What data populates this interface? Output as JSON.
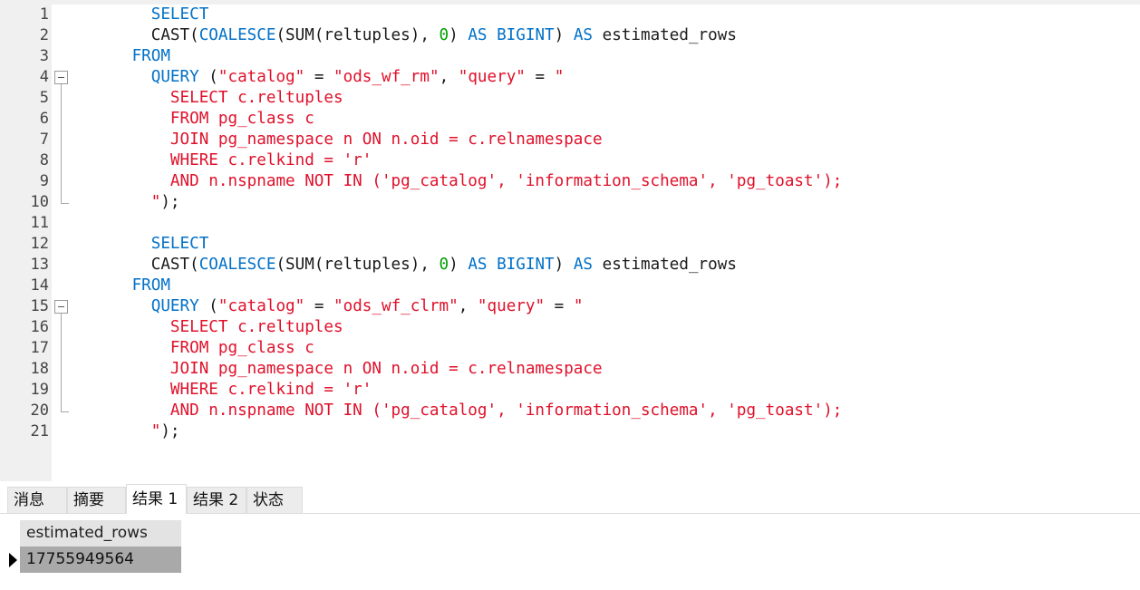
{
  "editor": {
    "lines": [
      {
        "n": "1",
        "tokens": [
          {
            "t": "        ",
            "c": "txt"
          },
          {
            "t": "SELECT",
            "c": "kw"
          }
        ]
      },
      {
        "n": "2",
        "tokens": [
          {
            "t": "        CAST(",
            "c": "txt"
          },
          {
            "t": "COALESCE",
            "c": "kw"
          },
          {
            "t": "(SUM(reltuples), ",
            "c": "txt"
          },
          {
            "t": "0",
            "c": "num"
          },
          {
            "t": ") ",
            "c": "txt"
          },
          {
            "t": "AS BIGINT",
            "c": "kw"
          },
          {
            "t": ") ",
            "c": "txt"
          },
          {
            "t": "AS",
            "c": "kw"
          },
          {
            "t": " estimated_rows",
            "c": "txt"
          }
        ]
      },
      {
        "n": "3",
        "tokens": [
          {
            "t": "      ",
            "c": "txt"
          },
          {
            "t": "FROM",
            "c": "kw"
          }
        ]
      },
      {
        "n": "4",
        "fold": "start",
        "tokens": [
          {
            "t": "        ",
            "c": "txt"
          },
          {
            "t": "QUERY",
            "c": "kw"
          },
          {
            "t": " (",
            "c": "txt"
          },
          {
            "t": "\"catalog\"",
            "c": "str"
          },
          {
            "t": " = ",
            "c": "txt"
          },
          {
            "t": "\"ods_wf_rm\"",
            "c": "str"
          },
          {
            "t": ", ",
            "c": "txt"
          },
          {
            "t": "\"query\"",
            "c": "str"
          },
          {
            "t": " = ",
            "c": "txt"
          },
          {
            "t": "\"",
            "c": "str"
          }
        ]
      },
      {
        "n": "5",
        "fold": "mid",
        "tokens": [
          {
            "t": "          SELECT c.reltuples",
            "c": "str"
          }
        ]
      },
      {
        "n": "6",
        "fold": "mid",
        "tokens": [
          {
            "t": "          FROM pg_class c",
            "c": "str"
          }
        ]
      },
      {
        "n": "7",
        "fold": "mid",
        "tokens": [
          {
            "t": "          JOIN pg_namespace n ON n.oid = c.relnamespace",
            "c": "str"
          }
        ]
      },
      {
        "n": "8",
        "fold": "mid",
        "tokens": [
          {
            "t": "          WHERE c.relkind = 'r'",
            "c": "str"
          }
        ]
      },
      {
        "n": "9",
        "fold": "mid",
        "tokens": [
          {
            "t": "          AND n.nspname NOT IN ('pg_catalog', 'information_schema', 'pg_toast');",
            "c": "str"
          }
        ]
      },
      {
        "n": "10",
        "fold": "end",
        "tokens": [
          {
            "t": "        ",
            "c": "txt"
          },
          {
            "t": "\"",
            "c": "str"
          },
          {
            "t": ");",
            "c": "txt"
          }
        ]
      },
      {
        "n": "11",
        "tokens": []
      },
      {
        "n": "12",
        "tokens": [
          {
            "t": "        ",
            "c": "txt"
          },
          {
            "t": "SELECT",
            "c": "kw"
          }
        ]
      },
      {
        "n": "13",
        "tokens": [
          {
            "t": "        CAST(",
            "c": "txt"
          },
          {
            "t": "COALESCE",
            "c": "kw"
          },
          {
            "t": "(SUM(reltuples), ",
            "c": "txt"
          },
          {
            "t": "0",
            "c": "num"
          },
          {
            "t": ") ",
            "c": "txt"
          },
          {
            "t": "AS BIGINT",
            "c": "kw"
          },
          {
            "t": ") ",
            "c": "txt"
          },
          {
            "t": "AS",
            "c": "kw"
          },
          {
            "t": " estimated_rows",
            "c": "txt"
          }
        ]
      },
      {
        "n": "14",
        "tokens": [
          {
            "t": "      ",
            "c": "txt"
          },
          {
            "t": "FROM",
            "c": "kw"
          }
        ]
      },
      {
        "n": "15",
        "fold": "start",
        "tokens": [
          {
            "t": "        ",
            "c": "txt"
          },
          {
            "t": "QUERY",
            "c": "kw"
          },
          {
            "t": " (",
            "c": "txt"
          },
          {
            "t": "\"catalog\"",
            "c": "str"
          },
          {
            "t": " = ",
            "c": "txt"
          },
          {
            "t": "\"ods_wf_clrm\"",
            "c": "str"
          },
          {
            "t": ", ",
            "c": "txt"
          },
          {
            "t": "\"query\"",
            "c": "str"
          },
          {
            "t": " = ",
            "c": "txt"
          },
          {
            "t": "\"",
            "c": "str"
          }
        ]
      },
      {
        "n": "16",
        "fold": "mid",
        "tokens": [
          {
            "t": "          SELECT c.reltuples",
            "c": "str"
          }
        ]
      },
      {
        "n": "17",
        "fold": "mid",
        "tokens": [
          {
            "t": "          FROM pg_class c",
            "c": "str"
          }
        ]
      },
      {
        "n": "18",
        "fold": "mid",
        "tokens": [
          {
            "t": "          JOIN pg_namespace n ON n.oid = c.relnamespace",
            "c": "str"
          }
        ]
      },
      {
        "n": "19",
        "fold": "mid",
        "tokens": [
          {
            "t": "          WHERE c.relkind = 'r'",
            "c": "str"
          }
        ]
      },
      {
        "n": "20",
        "fold": "end",
        "tokens": [
          {
            "t": "          AND n.nspname NOT IN ('pg_catalog', 'information_schema', 'pg_toast');",
            "c": "str"
          }
        ]
      },
      {
        "n": "21",
        "tokens": [
          {
            "t": "        ",
            "c": "txt"
          },
          {
            "t": "\"",
            "c": "str"
          },
          {
            "t": ");",
            "c": "txt"
          }
        ]
      }
    ]
  },
  "tabs": [
    {
      "label": "消息",
      "active": false
    },
    {
      "label": "摘要",
      "active": false
    },
    {
      "label": "结果 1",
      "active": true
    },
    {
      "label": "结果 2",
      "active": false
    },
    {
      "label": "状态",
      "active": false
    }
  ],
  "result": {
    "column_header": "estimated_rows",
    "rows": [
      {
        "estimated_rows": "17755949564"
      }
    ]
  }
}
